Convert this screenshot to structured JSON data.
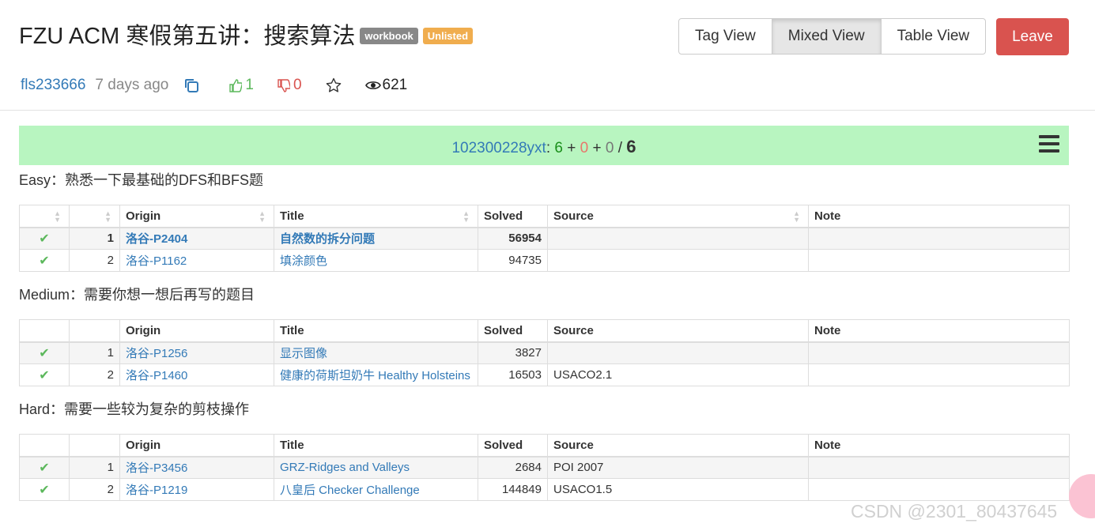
{
  "header": {
    "title": "FZU ACM 寒假第五讲：搜索算法",
    "badges": [
      "workbook",
      "Unlisted"
    ],
    "views": [
      "Tag View",
      "Mixed View",
      "Table View"
    ],
    "active_view": "Mixed View",
    "leave_label": "Leave"
  },
  "meta": {
    "author": "fls233666",
    "time": "7 days ago",
    "upvotes": "1",
    "downvotes": "0",
    "view_count": "621"
  },
  "status": {
    "user": "102300228yxt",
    "sep": ": ",
    "accepted": "6",
    "plus1": " + ",
    "wrong": "0",
    "plus2": " + ",
    "pending": "0",
    "slash": " / ",
    "total": "6"
  },
  "columns": {
    "origin": "Origin",
    "title": "Title",
    "solved": "Solved",
    "source": "Source",
    "note": "Note"
  },
  "sections": [
    {
      "label": "Easy：熟悉一下最基础的DFS和BFS题",
      "rows": [
        {
          "index": "1",
          "origin": "洛谷-P2404",
          "title": "自然数的拆分问题",
          "solved": "56954",
          "source": "",
          "note": ""
        },
        {
          "index": "2",
          "origin": "洛谷-P1162",
          "title": "填涂颜色",
          "solved": "94735",
          "source": "",
          "note": ""
        }
      ]
    },
    {
      "label": "Medium：需要你想一想后再写的题目",
      "rows": [
        {
          "index": "1",
          "origin": "洛谷-P1256",
          "title": "显示图像",
          "solved": "3827",
          "source": "",
          "note": ""
        },
        {
          "index": "2",
          "origin": "洛谷-P1460",
          "title": "健康的荷斯坦奶牛 Healthy Holsteins",
          "solved": "16503",
          "source": "USACO2.1",
          "note": ""
        }
      ]
    },
    {
      "label": "Hard：需要一些较为复杂的剪枝操作",
      "rows": [
        {
          "index": "1",
          "origin": "洛谷-P3456",
          "title": "GRZ-Ridges and Valleys",
          "solved": "2684",
          "source": "POI 2007",
          "note": ""
        },
        {
          "index": "2",
          "origin": "洛谷-P1219",
          "title": "八皇后 Checker Challenge",
          "solved": "144849",
          "source": "USACO1.5",
          "note": ""
        }
      ]
    }
  ],
  "watermark": "CSDN @2301_80437645",
  "colors": {
    "link": "#337ab7",
    "accepted_green": "#5cb85c",
    "leave_red": "#d9534f",
    "status_bg": "#b8f5c0",
    "badge_workbook": "#888888",
    "badge_unlisted": "#f0ad4e"
  },
  "icons": [
    "copy-icon",
    "thumbs-up-icon",
    "thumbs-down-icon",
    "star-icon",
    "eye-icon",
    "menu-icon",
    "check-icon",
    "sort-icon"
  ]
}
